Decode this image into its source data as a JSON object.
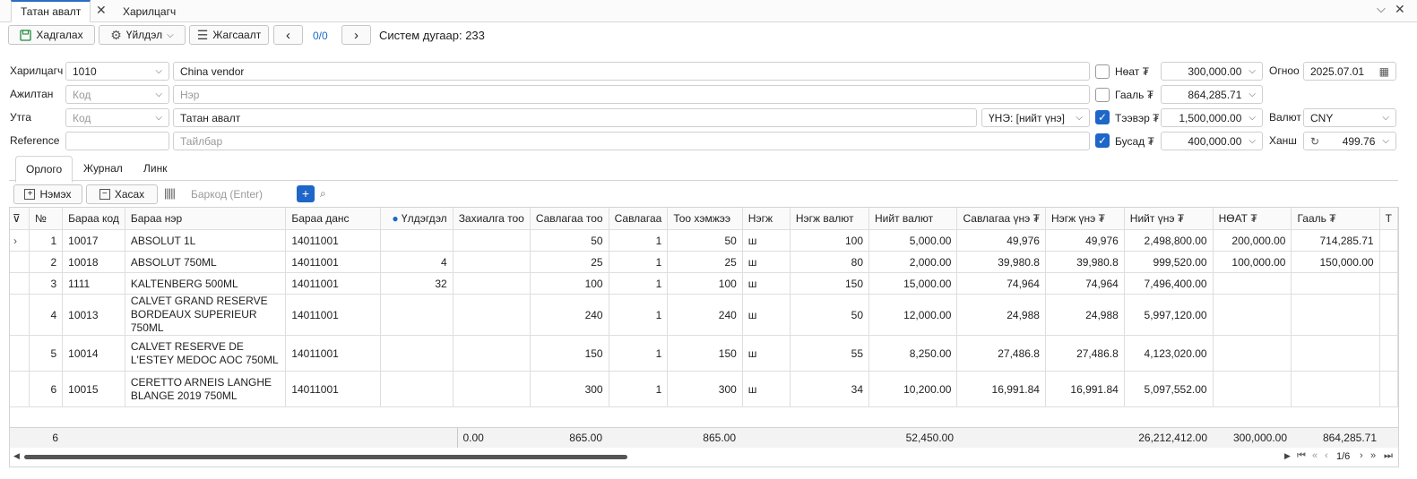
{
  "tabs": [
    {
      "label": "Татан авалт",
      "active": true,
      "closable": true
    },
    {
      "label": "Харилцагч",
      "active": false,
      "closable": false
    }
  ],
  "toolbar": {
    "save_label": "Хадгалах",
    "action_label": "Үйлдэл",
    "list_label": "Жагсаалт",
    "pager": "0/0",
    "system_number": "Систем дугаар: 233"
  },
  "form": {
    "partner_label": "Харилцагч",
    "partner_code": "1010",
    "partner_name": "China vendor",
    "employee_label": "Ажилтан",
    "employee_code_placeholder": "Код",
    "employee_name_placeholder": "Нэр",
    "warehouse_label": "Утга",
    "warehouse_code_placeholder": "Код",
    "warehouse_name": "Татан авалт",
    "vat_mode": "ҮНЭ: [нийт үнэ]",
    "reference_label": "Reference",
    "description_placeholder": "Тайлбар",
    "vat_label": "Нөат ₮",
    "vat_amount": "300,000.00",
    "vat_checked": false,
    "customs_label": "Гааль ₮",
    "customs_amount": "864,285.71",
    "customs_checked": false,
    "transport_label": "Тээвэр ₮",
    "transport_amount": "1,500,000.00",
    "transport_checked": true,
    "other_label": "Бусад ₮",
    "other_amount": "400,000.00",
    "other_checked": true,
    "date_label": "Огноо",
    "date": "2025.07.01",
    "currency_label": "Валют",
    "currency": "CNY",
    "rate_label": "Ханш",
    "rate": "499.76"
  },
  "inner_tabs": [
    "Орлого",
    "Журнал",
    "Линк"
  ],
  "grid_toolbar": {
    "add_label": "Нэмэх",
    "remove_label": "Хасах",
    "barcode_placeholder": "Баркод (Enter)"
  },
  "grid": {
    "columns": [
      "№",
      "Бараа код",
      "Бараа нэр",
      "Бараа данс",
      "Үлдэгдэл",
      "Захиалга тоо",
      "Савлагаа тоо",
      "Савлагаа",
      "Тоо хэмжээ",
      "Нэгж",
      "Нэгж валют",
      "Нийт валют",
      "Савлагаа үнэ ₮",
      "Нэгж үнэ ₮",
      "Нийт үнэ ₮",
      "НӨАТ ₮",
      "Гааль ₮",
      "Т"
    ],
    "rows": [
      [
        "1",
        "10017",
        "ABSOLUT 1L",
        "14011001",
        "",
        "",
        "50",
        "1",
        "50",
        "ш",
        "100",
        "5,000.00",
        "49,976",
        "49,976",
        "2,498,800.00",
        "200,000.00",
        "714,285.71",
        ""
      ],
      [
        "2",
        "10018",
        "ABSOLUT 750ML",
        "14011001",
        "4",
        "",
        "25",
        "1",
        "25",
        "ш",
        "80",
        "2,000.00",
        "39,980.8",
        "39,980.8",
        "999,520.00",
        "100,000.00",
        "150,000.00",
        ""
      ],
      [
        "3",
        "1111",
        "KALTENBERG 500ML",
        "14011001",
        "32",
        "",
        "100",
        "1",
        "100",
        "ш",
        "150",
        "15,000.00",
        "74,964",
        "74,964",
        "7,496,400.00",
        "",
        "",
        ""
      ],
      [
        "4",
        "10013",
        "CALVET GRAND RESERVE BORDEAUX SUPERIEUR 750ML",
        "14011001",
        "",
        "",
        "240",
        "1",
        "240",
        "ш",
        "50",
        "12,000.00",
        "24,988",
        "24,988",
        "5,997,120.00",
        "",
        "",
        ""
      ],
      [
        "5",
        "10014",
        "CALVET RESERVE DE L'ESTEY MEDOC AOC 750ML",
        "14011001",
        "",
        "",
        "150",
        "1",
        "150",
        "ш",
        "55",
        "8,250.00",
        "27,486.8",
        "27,486.8",
        "4,123,020.00",
        "",
        "",
        ""
      ],
      [
        "6",
        "10015",
        "CERETTO ARNEIS LANGHE BLANGE 2019 750ML",
        "14011001",
        "",
        "",
        "300",
        "1",
        "300",
        "ш",
        "34",
        "10,200.00",
        "16,991.84",
        "16,991.84",
        "5,097,552.00",
        "",
        "",
        ""
      ]
    ],
    "footer": [
      "6",
      "",
      "",
      "",
      "",
      "0.00",
      "865.00",
      "",
      "865.00",
      "",
      "",
      "52,450.00",
      "",
      "",
      "26,212,412.00",
      "300,000.00",
      "864,285.71",
      ""
    ],
    "page": "1/6"
  }
}
